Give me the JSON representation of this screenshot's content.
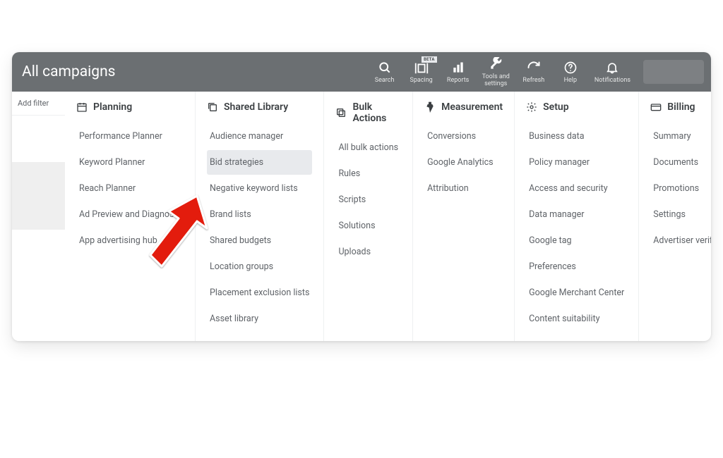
{
  "header": {
    "title": "All campaigns",
    "actions": [
      {
        "icon": "search",
        "label": "Search"
      },
      {
        "icon": "spacing",
        "label": "Spacing",
        "badge": "BETA"
      },
      {
        "icon": "reports",
        "label": "Reports"
      },
      {
        "icon": "tools",
        "label": "Tools and settings"
      },
      {
        "icon": "refresh",
        "label": "Refresh"
      },
      {
        "icon": "help",
        "label": "Help"
      },
      {
        "icon": "notifications",
        "label": "Notifications"
      }
    ]
  },
  "sidebar": {
    "add_filter": "Add filter"
  },
  "columns": [
    {
      "icon": "planning",
      "title": "Planning",
      "items": [
        "Performance Planner",
        "Keyword Planner",
        "Reach Planner",
        "Ad Preview and Diagnosis",
        "App advertising hub"
      ]
    },
    {
      "icon": "shared-library",
      "title": "Shared Library",
      "items": [
        "Audience manager",
        "Bid strategies",
        "Negative keyword lists",
        "Brand lists",
        "Shared budgets",
        "Location groups",
        "Placement exclusion lists",
        "Asset library"
      ]
    },
    {
      "icon": "bulk-actions",
      "title": "Bulk Actions",
      "items": [
        "All bulk actions",
        "Rules",
        "Scripts",
        "Solutions",
        "Uploads"
      ]
    },
    {
      "icon": "measurement",
      "title": "Measurement",
      "items": [
        "Conversions",
        "Google Analytics",
        "Attribution"
      ]
    },
    {
      "icon": "setup",
      "title": "Setup",
      "items": [
        "Business data",
        "Policy manager",
        "Access and security",
        "Data manager",
        "Google tag",
        "Preferences",
        "Google Merchant Center",
        "Content suitability"
      ]
    },
    {
      "icon": "billing",
      "title": "Billing",
      "items": [
        "Summary",
        "Documents",
        "Promotions",
        "Settings",
        "Advertiser verification"
      ]
    }
  ],
  "highlighted": {
    "col": 1,
    "item": 1
  }
}
